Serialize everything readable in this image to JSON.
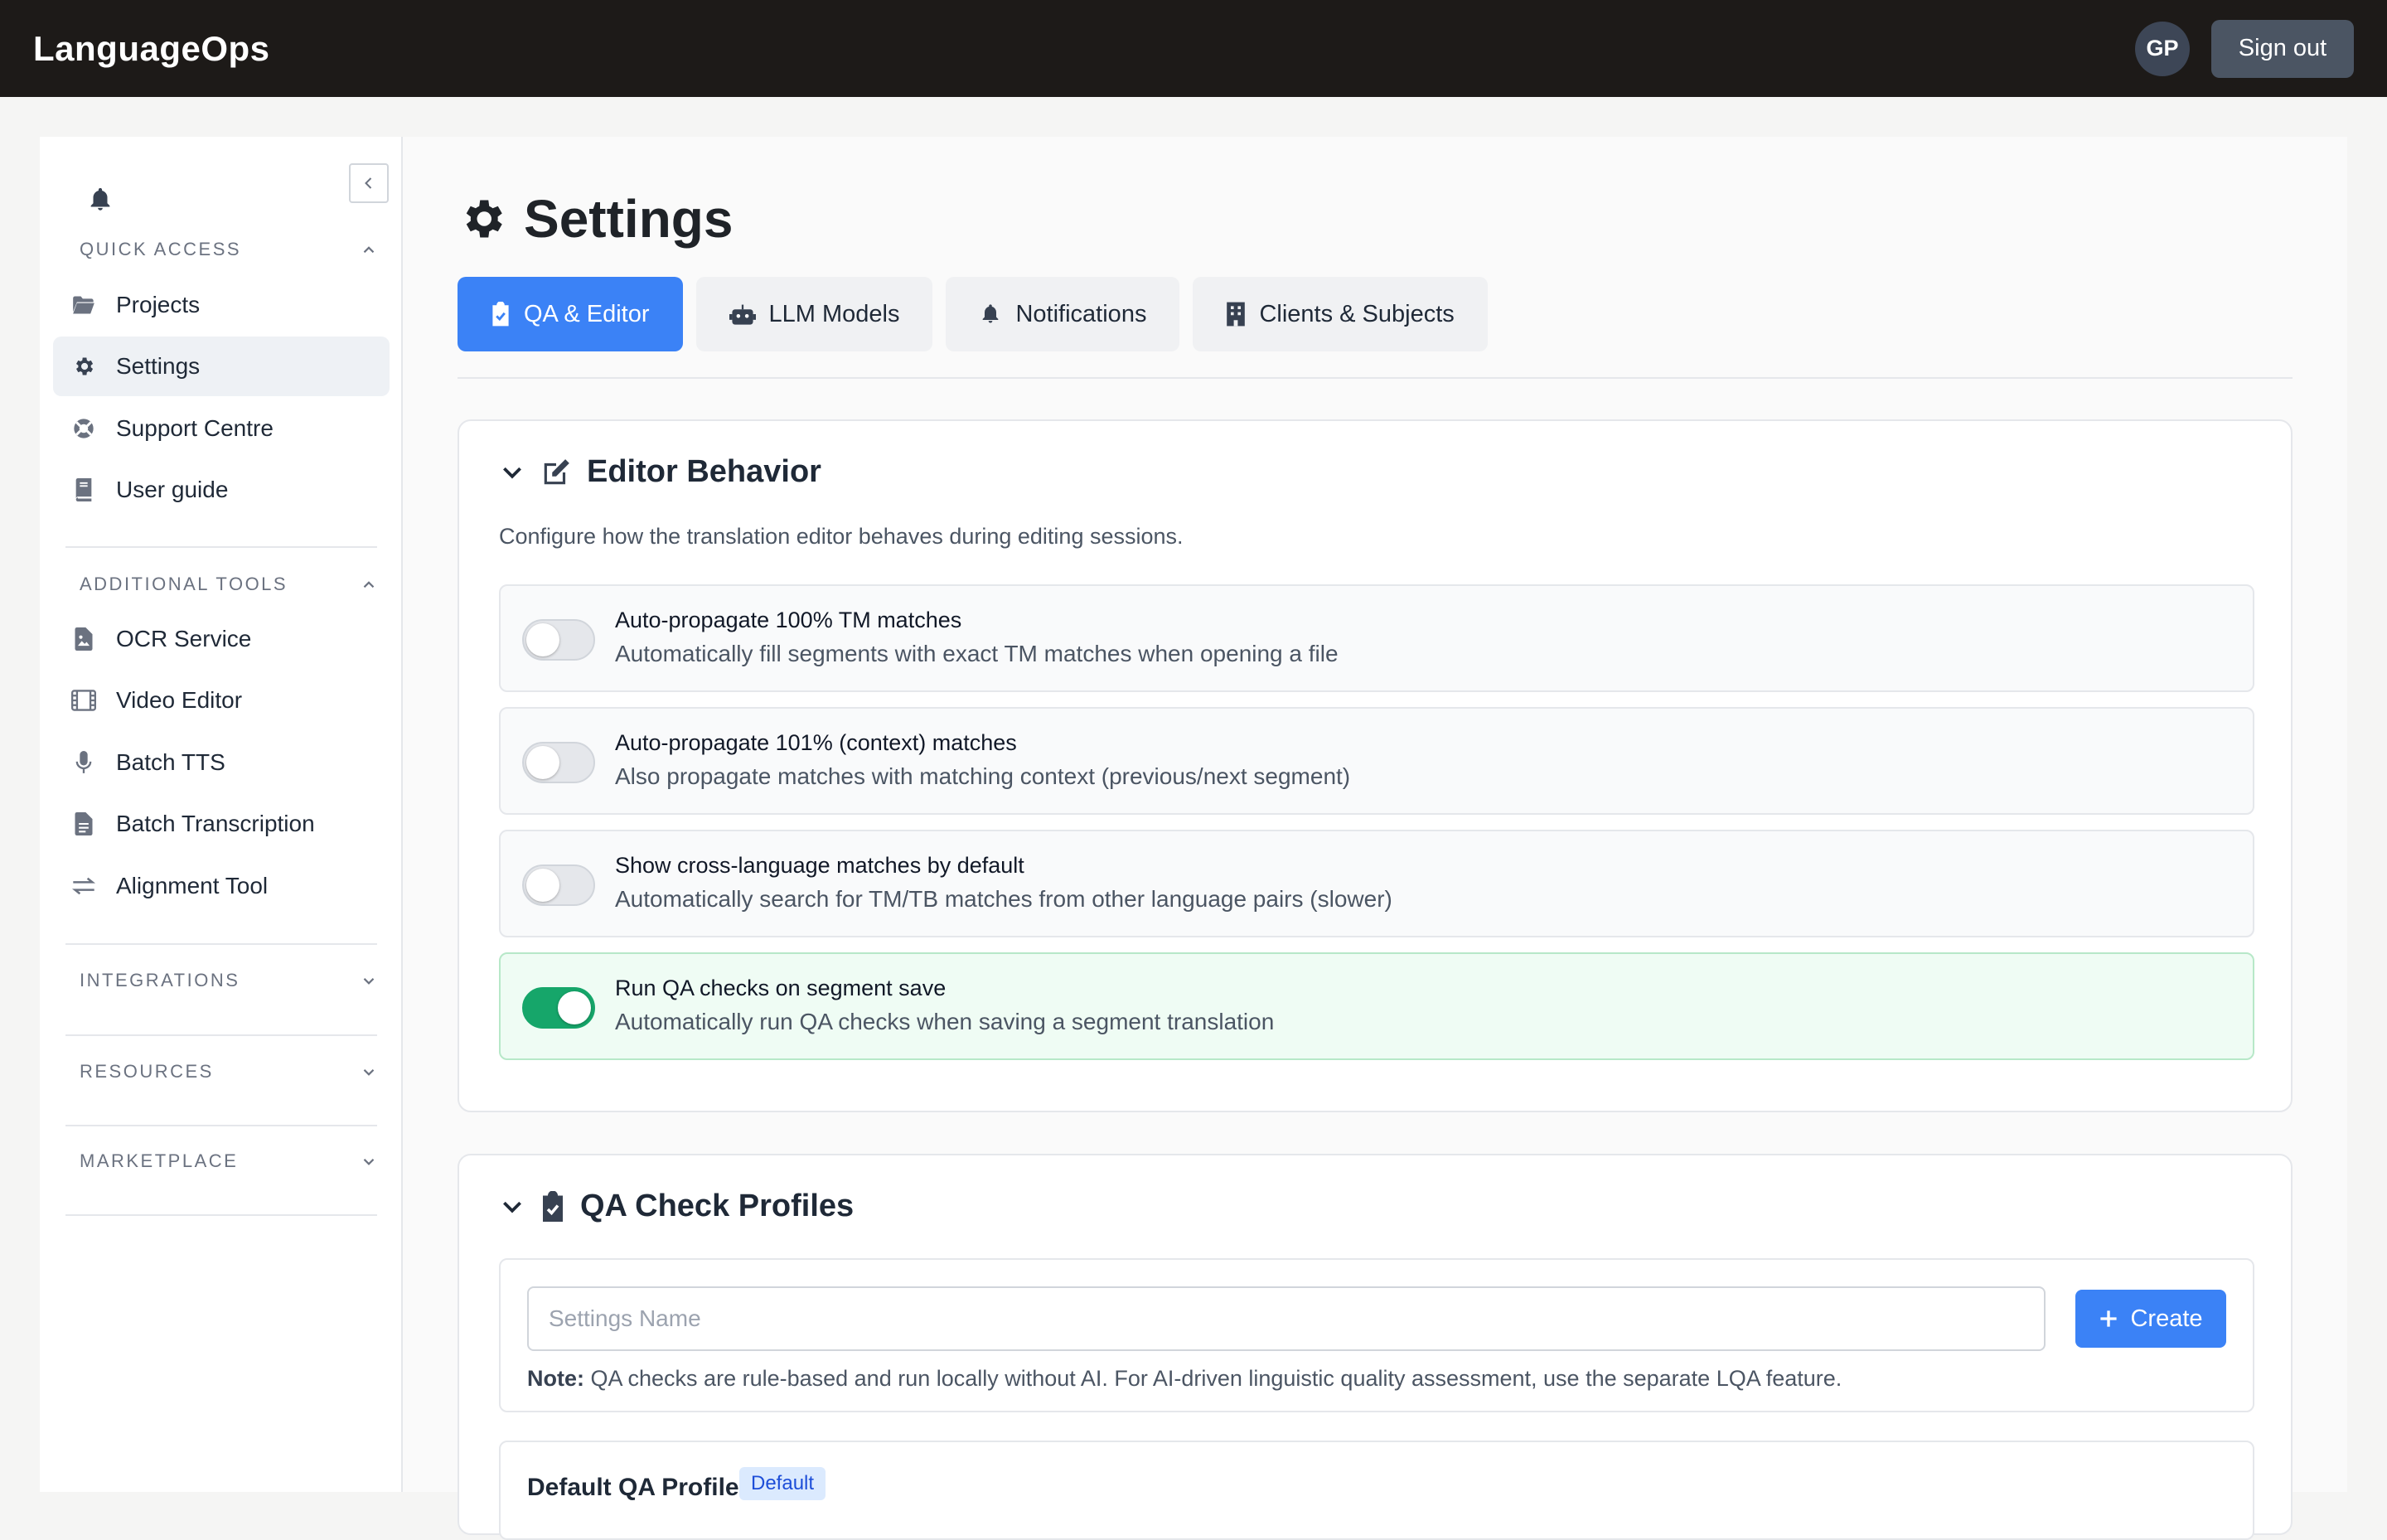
{
  "app": {
    "brand": "LanguageOps",
    "avatar_initials": "GP",
    "sign_out_label": "Sign out"
  },
  "sidebar": {
    "sections": [
      {
        "label": "QUICK ACCESS",
        "expanded": true
      },
      {
        "label": "ADDITIONAL TOOLS",
        "expanded": true
      },
      {
        "label": "INTEGRATIONS",
        "expanded": false
      },
      {
        "label": "RESOURCES",
        "expanded": false
      },
      {
        "label": "MARKETPLACE",
        "expanded": false
      }
    ],
    "quick_access": [
      {
        "label": "Projects",
        "icon": "folder-icon"
      },
      {
        "label": "Settings",
        "icon": "gear-icon",
        "active": true
      },
      {
        "label": "Support Centre",
        "icon": "lifebuoy-icon"
      },
      {
        "label": "User guide",
        "icon": "book-icon"
      }
    ],
    "additional_tools": [
      {
        "label": "OCR Service",
        "icon": "file-image-icon"
      },
      {
        "label": "Video Editor",
        "icon": "film-icon"
      },
      {
        "label": "Batch TTS",
        "icon": "microphone-icon"
      },
      {
        "label": "Batch Transcription",
        "icon": "file-text-icon"
      },
      {
        "label": "Alignment Tool",
        "icon": "arrows-exchange-icon"
      }
    ]
  },
  "page": {
    "title": "Settings",
    "tabs": [
      {
        "label": "QA & Editor",
        "icon": "clipboard-check-icon",
        "active": true
      },
      {
        "label": "LLM Models",
        "icon": "robot-icon"
      },
      {
        "label": "Notifications",
        "icon": "bell-icon"
      },
      {
        "label": "Clients & Subjects",
        "icon": "building-icon"
      }
    ]
  },
  "editor_behavior": {
    "title": "Editor Behavior",
    "description": "Configure how the translation editor behaves during editing sessions.",
    "options": [
      {
        "title": "Auto-propagate 100% TM matches",
        "subtitle": "Automatically fill segments with exact TM matches when opening a file",
        "enabled": false
      },
      {
        "title": "Auto-propagate 101% (context) matches",
        "subtitle": "Also propagate matches with matching context (previous/next segment)",
        "enabled": false
      },
      {
        "title": "Show cross-language matches by default",
        "subtitle": "Automatically search for TM/TB matches from other language pairs (slower)",
        "enabled": false
      },
      {
        "title": "Run QA checks on segment save",
        "subtitle": "Automatically run QA checks when saving a segment translation",
        "enabled": true
      }
    ]
  },
  "qa_profiles": {
    "title": "QA Check Profiles",
    "input_placeholder": "Settings Name",
    "create_label": "Create",
    "note_label": "Note:",
    "note_text": " QA checks are rule-based and run locally without AI. For AI-driven linguistic quality assessment, use the separate LQA feature.",
    "profile_name": "Default QA Profile",
    "profile_badge": "Default"
  },
  "colors": {
    "accent": "#3b82f6",
    "toggle_on": "#16a66a",
    "topbar": "#1d1a18"
  }
}
